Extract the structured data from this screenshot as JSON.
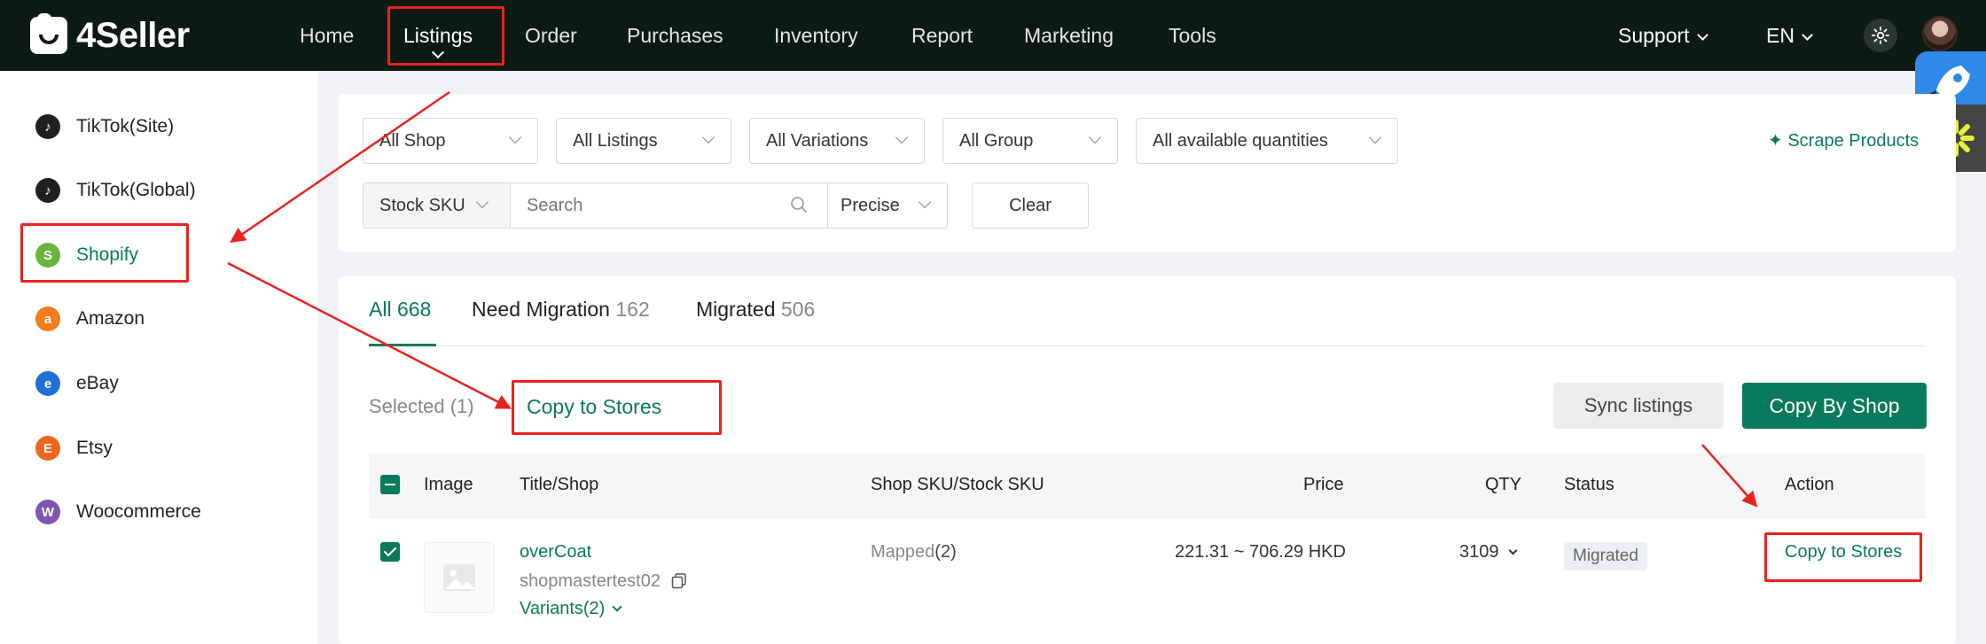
{
  "app": {
    "logo_text": "4Seller"
  },
  "nav": {
    "items": [
      "Home",
      "Listings",
      "Order",
      "Purchases",
      "Inventory",
      "Report",
      "Marketing",
      "Tools"
    ],
    "support": "Support",
    "language": "EN"
  },
  "sidebar": {
    "items": [
      {
        "label": "TikTok(Site)",
        "icon": "tiktok-icon",
        "color": "#1f1f1f"
      },
      {
        "label": "TikTok(Global)",
        "icon": "tiktok-icon",
        "color": "#1f1f1f"
      },
      {
        "label": "Shopify",
        "icon": "shopify-icon",
        "color": "#6bb33f"
      },
      {
        "label": "Amazon",
        "icon": "amazon-icon",
        "color": "#f07c1c"
      },
      {
        "label": "eBay",
        "icon": "ebay-icon",
        "color": "#1f6fd6"
      },
      {
        "label": "Etsy",
        "icon": "etsy-icon",
        "color": "#f1641e"
      },
      {
        "label": "Woocommerce",
        "icon": "woocommerce-icon",
        "color": "#7f54b3"
      }
    ]
  },
  "filters": {
    "shop": "All Shop",
    "listings": "All Listings",
    "variations": "All Variations",
    "group": "All Group",
    "quantities": "All available quantities",
    "search_field": "Stock SKU",
    "search_placeholder": "Search",
    "match_mode": "Precise",
    "clear": "Clear",
    "scrape": "Scrape Products"
  },
  "tabs": [
    {
      "label": "All",
      "count": "668"
    },
    {
      "label": "Need Migration",
      "count": "162"
    },
    {
      "label": "Migrated",
      "count": "506"
    }
  ],
  "toolbar": {
    "selected": "Selected (1)",
    "copy_to_stores": "Copy to Stores",
    "sync": "Sync listings",
    "copy_by_shop": "Copy By Shop"
  },
  "table": {
    "headers": [
      "Image",
      "Title/Shop",
      "Shop SKU/Stock SKU",
      "Price",
      "QTY",
      "Status",
      "Action"
    ],
    "rows": [
      {
        "title": "overCoat",
        "shop": "shopmastertest02",
        "variants": "Variants(2)",
        "sku_label": "Mapped",
        "sku_count": "(2)",
        "price": "221.31 ~ 706.29 HKD",
        "qty": "3109",
        "status": "Migrated",
        "action": "Copy to Stores"
      }
    ]
  },
  "colors": {
    "brand": "#0a7a5c",
    "nav_bg": "#0b1a12",
    "annotation": "#e8231f"
  }
}
